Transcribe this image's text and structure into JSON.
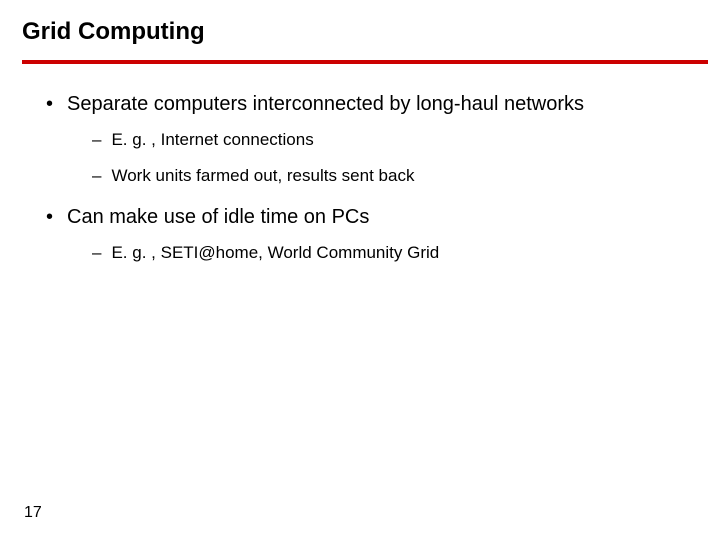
{
  "slide": {
    "title": "Grid Computing",
    "bullets": [
      {
        "text": "Separate computers interconnected by long-haul networks",
        "sub": [
          "E. g. , Internet connections",
          "Work units farmed out, results sent back"
        ]
      },
      {
        "text": "Can make use of idle time on PCs",
        "sub": [
          "E. g. , SETI@home, World Community Grid"
        ]
      }
    ],
    "page_number": "17"
  }
}
